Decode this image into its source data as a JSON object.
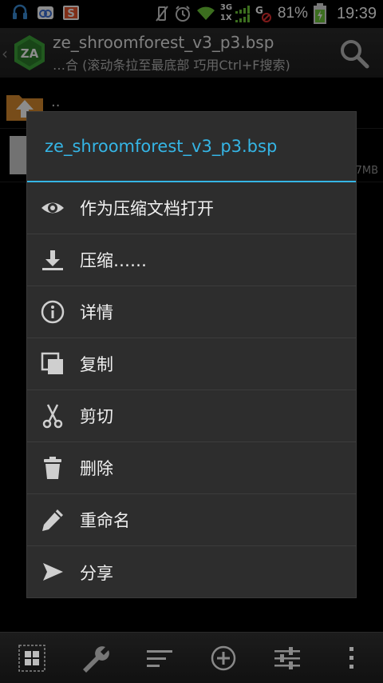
{
  "status_bar": {
    "battery_percent": "81%",
    "signal_label_top": "3G",
    "signal_label_bottom": "1X",
    "time": "19:39"
  },
  "app_bar": {
    "title": "ze_shroomforest_v3_p3.bsp",
    "subtitle": "…合 (滚动条拉至最底部 巧用Ctrl+F搜索)"
  },
  "file_list": {
    "parent_label": "..",
    "file_size_fragment": "7MB"
  },
  "dialog": {
    "title": "ze_shroomforest_v3_p3.bsp",
    "items": [
      {
        "label": "作为压缩文档打开",
        "icon": "eye-icon"
      },
      {
        "label": "压缩……",
        "icon": "download-icon"
      },
      {
        "label": "详情",
        "icon": "info-icon"
      },
      {
        "label": "复制",
        "icon": "copy-icon"
      },
      {
        "label": "剪切",
        "icon": "scissors-icon"
      },
      {
        "label": "删除",
        "icon": "trash-icon"
      },
      {
        "label": "重命名",
        "icon": "pencil-icon"
      },
      {
        "label": "分享",
        "icon": "share-icon"
      }
    ]
  },
  "toolbar": {
    "icons": [
      "grid-icon",
      "wrench-icon",
      "sort-icon",
      "add-icon",
      "settings-sliders-icon",
      "overflow-menu-icon"
    ]
  },
  "colors": {
    "accent": "#35b5e5",
    "dialog_bg": "#2d2d2d",
    "logo_green": "#3da33a"
  }
}
